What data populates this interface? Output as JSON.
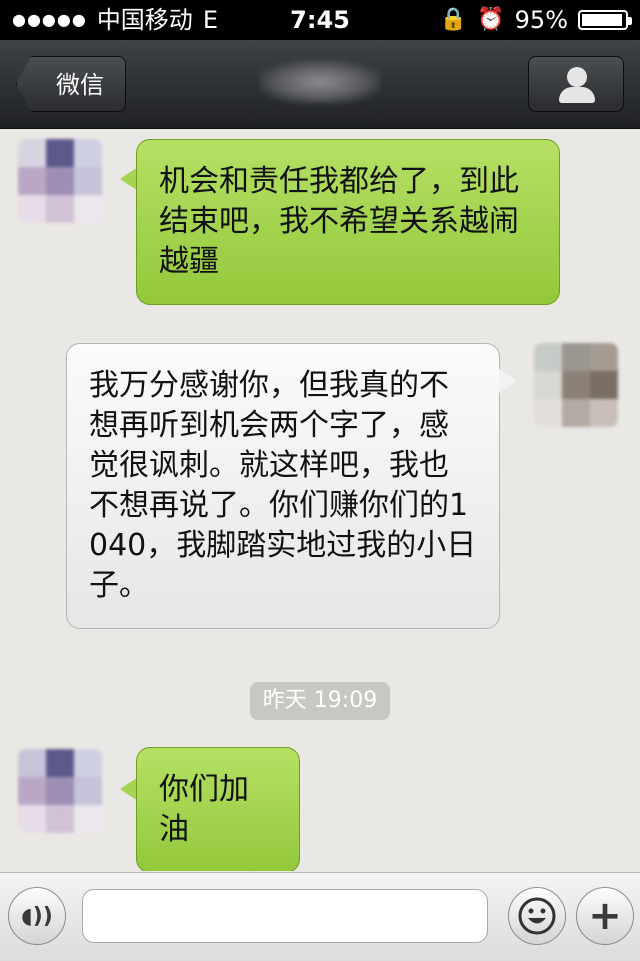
{
  "status_bar": {
    "signal": "●●●●●",
    "carrier": "中国移动",
    "network": "E",
    "time": "7:45",
    "battery_percent": "95%",
    "battery_level": 0.95
  },
  "nav": {
    "back_label": "微信"
  },
  "messages": [
    {
      "side": "right",
      "text": "机会和责任我都给了，到此结束吧，我不希望关系越闹越疆"
    },
    {
      "side": "left",
      "text": "我万分感谢你，但我真的不想再听到机会两个字了，感觉很讽刺。就这样吧，我也不想再说了。你们赚你们的1040，我脚踏实地过我的小日子。"
    },
    {
      "side": "right",
      "text": "你们加油"
    }
  ],
  "timestamp": "昨天 19:09",
  "input": {
    "placeholder": ""
  },
  "colors": {
    "sent_bubble": "#a6d452",
    "received_bubble": "#f2f2f2",
    "nav_bar": "#2c2e31"
  }
}
